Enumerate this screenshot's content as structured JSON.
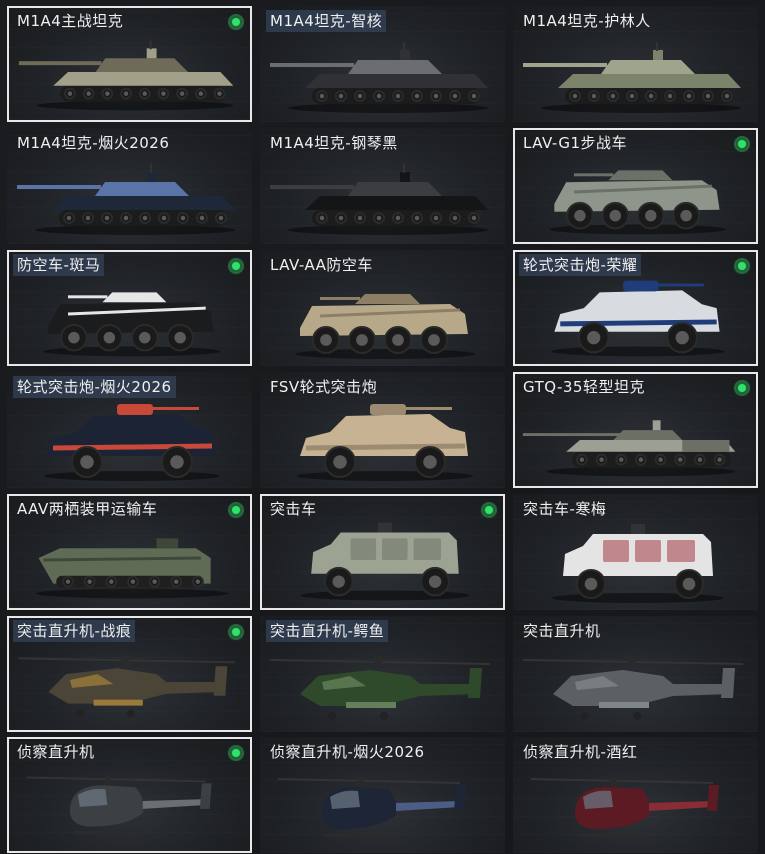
{
  "vehicles": [
    {
      "name": "M1A4主战坦克",
      "kind": "tank",
      "color": "#a3a08a",
      "accent": "#6e6b58",
      "selected": true,
      "owned": true,
      "highlight": false,
      "icon": "tank-icon"
    },
    {
      "name": "M1A4坦克-智核",
      "kind": "tank",
      "color": "#2f3134",
      "accent": "#6a6d72",
      "selected": false,
      "owned": false,
      "highlight": true,
      "icon": "tank-icon"
    },
    {
      "name": "M1A4坦克-护林人",
      "kind": "tank",
      "color": "#7b836b",
      "accent": "#9ea58c",
      "selected": false,
      "owned": false,
      "highlight": false,
      "icon": "tank-icon"
    },
    {
      "name": "M1A4坦克-烟火2026",
      "kind": "tank",
      "color": "#1e2838",
      "accent": "#5b74a8",
      "selected": false,
      "owned": false,
      "highlight": false,
      "icon": "tank-icon"
    },
    {
      "name": "M1A4坦克-钢琴黑",
      "kind": "tank",
      "color": "#141517",
      "accent": "#3b3d40",
      "selected": false,
      "owned": false,
      "highlight": false,
      "icon": "tank-icon"
    },
    {
      "name": "LAV-G1步战车",
      "kind": "lav",
      "color": "#8e958a",
      "accent": "#6b7168",
      "selected": true,
      "owned": true,
      "highlight": false,
      "icon": "ifv-icon"
    },
    {
      "name": "防空车-斑马",
      "kind": "lav",
      "color": "#1b1c1e",
      "accent": "#e6e6e6",
      "selected": true,
      "owned": true,
      "highlight": true,
      "icon": "aa-vehicle-icon"
    },
    {
      "name": "LAV-AA防空车",
      "kind": "lav",
      "color": "#b8a88a",
      "accent": "#8d7f66",
      "selected": false,
      "owned": false,
      "highlight": false,
      "icon": "aa-vehicle-icon"
    },
    {
      "name": "轮式突击炮-荣耀",
      "kind": "apc",
      "color": "#d8dce0",
      "accent": "#1f3d7a",
      "selected": true,
      "owned": true,
      "highlight": true,
      "icon": "assault-gun-icon"
    },
    {
      "name": "轮式突击炮-烟火2026",
      "kind": "apc",
      "color": "#1b2335",
      "accent": "#c8483a",
      "selected": false,
      "owned": false,
      "highlight": true,
      "icon": "assault-gun-icon"
    },
    {
      "name": "FSV轮式突击炮",
      "kind": "apc",
      "color": "#c7b394",
      "accent": "#9c8b70",
      "selected": false,
      "owned": false,
      "highlight": false,
      "icon": "assault-gun-icon"
    },
    {
      "name": "GTQ-35轻型坦克",
      "kind": "lighttank",
      "color": "#9c9f93",
      "accent": "#6c6f66",
      "selected": true,
      "owned": true,
      "highlight": false,
      "icon": "light-tank-icon"
    },
    {
      "name": "AAV两栖装甲运输车",
      "kind": "aav",
      "color": "#5f6b55",
      "accent": "#3f4838",
      "selected": true,
      "owned": true,
      "highlight": false,
      "icon": "amphibious-icon"
    },
    {
      "name": "突击车",
      "kind": "mrap",
      "color": "#9ca392",
      "accent": "#6f7568",
      "selected": true,
      "owned": true,
      "highlight": false,
      "icon": "assault-vehicle-icon"
    },
    {
      "name": "突击车-寒梅",
      "kind": "mrap",
      "color": "#e4e4e4",
      "accent": "#a33a44",
      "selected": false,
      "owned": false,
      "highlight": false,
      "icon": "assault-vehicle-icon"
    },
    {
      "name": "突击直升机-战痕",
      "kind": "apache",
      "color": "#4a4536",
      "accent": "#9b7b3c",
      "selected": true,
      "owned": true,
      "highlight": true,
      "icon": "helicopter-icon"
    },
    {
      "name": "突击直升机-鳄鱼",
      "kind": "apache",
      "color": "#2e4a2a",
      "accent": "#63805a",
      "selected": false,
      "owned": false,
      "highlight": true,
      "icon": "helicopter-icon"
    },
    {
      "name": "突击直升机",
      "kind": "apache",
      "color": "#5c6064",
      "accent": "#80858a",
      "selected": false,
      "owned": false,
      "highlight": false,
      "icon": "helicopter-icon"
    },
    {
      "name": "侦察直升机",
      "kind": "scout",
      "color": "#3d4043",
      "accent": "#6b6f73",
      "selected": true,
      "owned": true,
      "highlight": false,
      "icon": "scout-helicopter-icon"
    },
    {
      "name": "侦察直升机-烟火2026",
      "kind": "scout",
      "color": "#1e2536",
      "accent": "#4c5e88",
      "selected": false,
      "owned": false,
      "highlight": false,
      "icon": "scout-helicopter-icon"
    },
    {
      "name": "侦察直升机-酒红",
      "kind": "scout",
      "color": "#5c1a22",
      "accent": "#8a2c36",
      "selected": false,
      "owned": false,
      "highlight": false,
      "icon": "scout-helicopter-icon"
    }
  ]
}
